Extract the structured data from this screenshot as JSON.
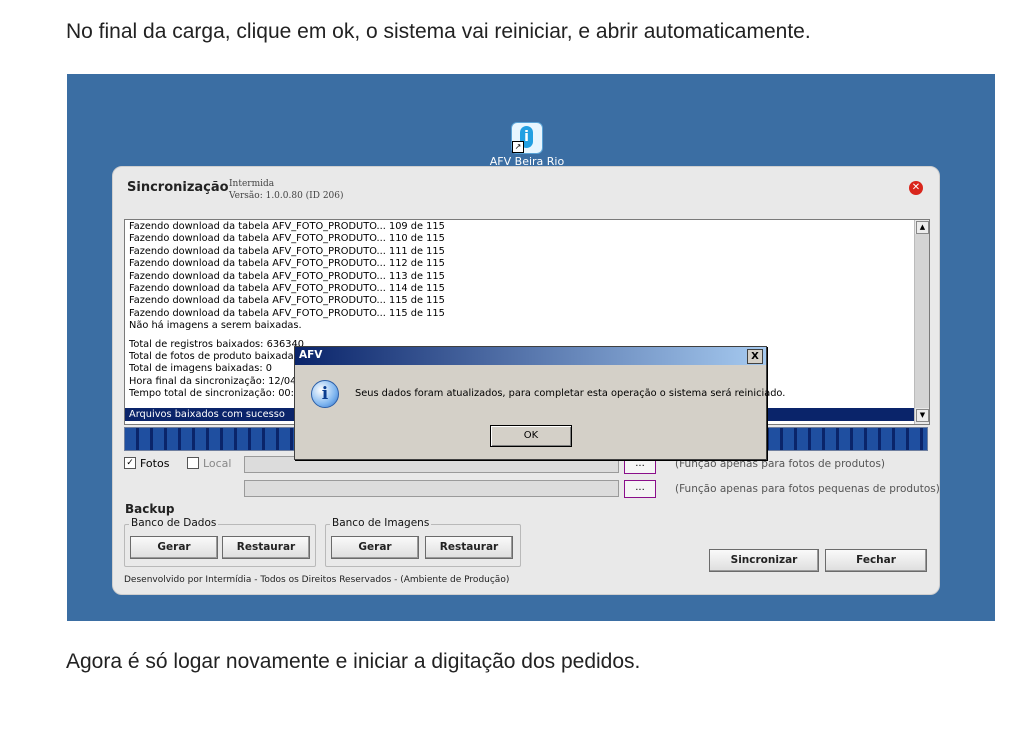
{
  "doc": {
    "top_text": "No final da carga, clique em ok, o sistema vai reiniciar, e abrir automaticamente.",
    "bottom_text": "Agora é só logar novamente e iniciar a digitação dos pedidos."
  },
  "desktop": {
    "icon_label": "AFV Beira Rio",
    "background_color": "#3b6ea3"
  },
  "app": {
    "title": "Sincronização",
    "company": "Intermida",
    "version": "Versão: 1.0.0.80 (ID 206)",
    "log": [
      "Fazendo download da tabela AFV_FOTO_PRODUTO... 109 de 115",
      "Fazendo download da tabela AFV_FOTO_PRODUTO... 110 de 115",
      "Fazendo download da tabela AFV_FOTO_PRODUTO... 111 de 115",
      "Fazendo download da tabela AFV_FOTO_PRODUTO... 112 de 115",
      "Fazendo download da tabela AFV_FOTO_PRODUTO... 113 de 115",
      "Fazendo download da tabela AFV_FOTO_PRODUTO... 114 de 115",
      "Fazendo download da tabela AFV_FOTO_PRODUTO... 115 de 115",
      "Fazendo download da tabela AFV_FOTO_PRODUTO... 115 de 115",
      "Não há imagens a serem baixadas."
    ],
    "summary": [
      "Total de registros baixados: 636340",
      "Total de fotos de produto baixadas: 1",
      "Total de imagens baixadas: 0",
      "Hora final da sincronização: 12/04/2",
      "Tempo total de sincronização: 00:05"
    ],
    "selected_line": "Arquivos baixados com sucesso",
    "progress_percent": 100,
    "options": {
      "fotos_label": "Fotos",
      "fotos_checked": true,
      "local_label": "Local",
      "local_checked": false,
      "browse_label": "...",
      "hint1": "(Função apenas para fotos de produtos)",
      "hint2": "(Função apenas para fotos pequenas de produtos)"
    },
    "backup": {
      "title": "Backup",
      "db_group": "Banco de Dados",
      "img_group": "Banco de Imagens",
      "gerar": "Gerar",
      "restaurar": "Restaurar"
    },
    "sincronizar": "Sincronizar",
    "fechar": "Fechar",
    "footer": "Desenvolvido por Intermídia - Todos os Direitos Reservados - (Ambiente de Produção)"
  },
  "dialog": {
    "title": "AFV",
    "close": "X",
    "message": "Seus dados foram atualizados, para completar esta operação o sistema será reiniciado.",
    "ok": "OK"
  }
}
